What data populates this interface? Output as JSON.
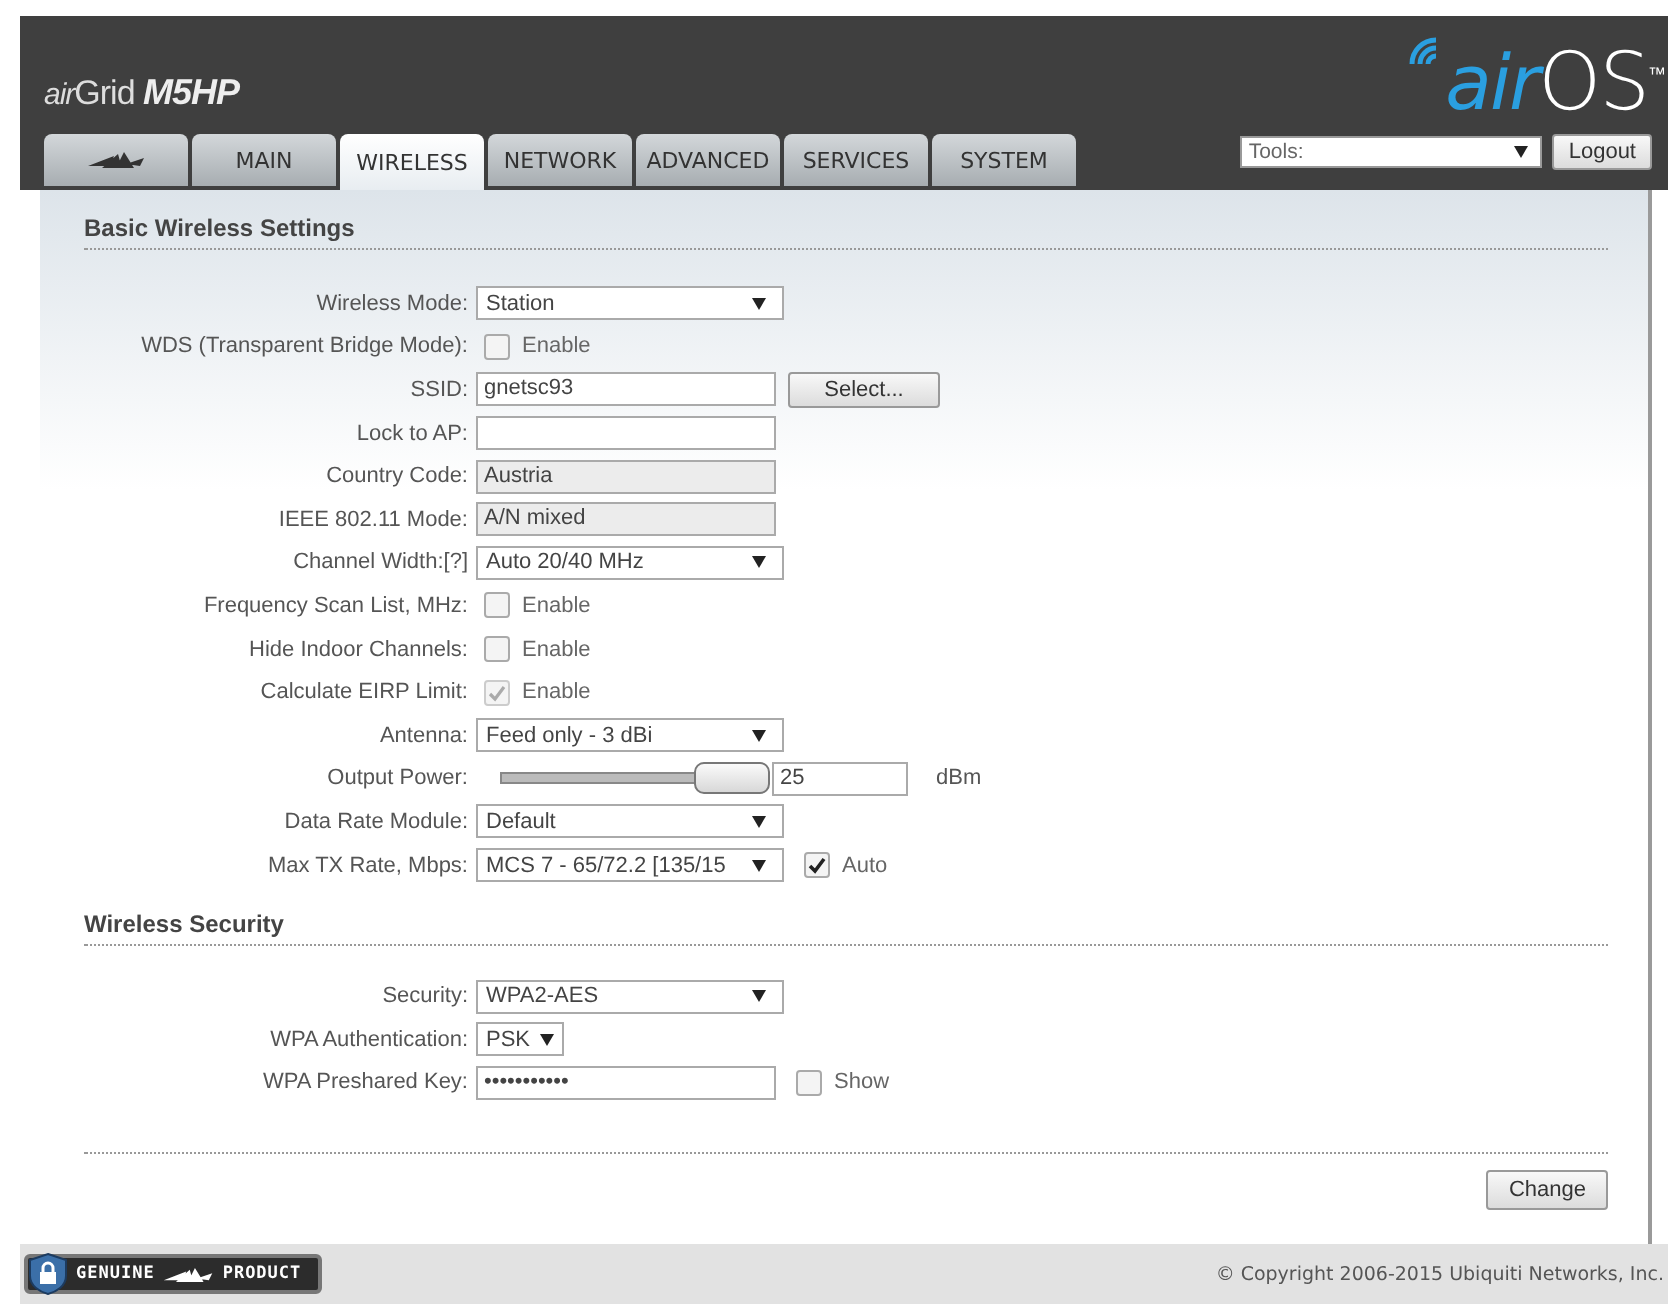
{
  "header": {
    "product": {
      "prefix": "air",
      "name": "Grid",
      "model": "M5HP"
    },
    "brand": {
      "prefix": "air",
      "name": "OS",
      "mark": "™"
    }
  },
  "tabs": [
    {
      "kind": "logo",
      "selected": false
    },
    {
      "kind": "text",
      "label": "MAIN",
      "selected": false
    },
    {
      "kind": "text",
      "label": "WIRELESS",
      "selected": true
    },
    {
      "kind": "text",
      "label": "NETWORK",
      "selected": false
    },
    {
      "kind": "text",
      "label": "ADVANCED",
      "selected": false
    },
    {
      "kind": "text",
      "label": "SERVICES",
      "selected": false
    },
    {
      "kind": "text",
      "label": "SYSTEM",
      "selected": false
    }
  ],
  "tools": {
    "value": "Tools:"
  },
  "logout": "Logout",
  "sections": [
    {
      "title": "Basic Wireless Settings",
      "rows": [
        {
          "kind": "select",
          "label": "Wireless Mode:",
          "value": "Station"
        },
        {
          "kind": "checkbox",
          "label": "WDS (Transparent Bridge Mode):",
          "checked": false,
          "disabled": false,
          "text": "Enable"
        },
        {
          "kind": "input",
          "label": "SSID:",
          "value": "gnetsc93",
          "button": "Select..."
        },
        {
          "kind": "input",
          "label": "Lock to AP:"
        },
        {
          "kind": "readonly",
          "label": "Country Code:",
          "value": "Austria"
        },
        {
          "kind": "readonly",
          "label": "IEEE 802.11 Mode:",
          "value": "A/N mixed"
        },
        {
          "kind": "select",
          "label": "Channel Width:[?]",
          "value": "Auto 20/40 MHz"
        },
        {
          "kind": "checkbox",
          "label": "Frequency Scan List, MHz:",
          "checked": false,
          "disabled": false,
          "text": "Enable"
        },
        {
          "kind": "checkbox",
          "label": "Hide Indoor Channels:",
          "checked": false,
          "disabled": false,
          "text": "Enable"
        },
        {
          "kind": "checkbox",
          "label": "Calculate EIRP Limit:",
          "checked": true,
          "disabled": true,
          "text": "Enable"
        },
        {
          "kind": "select",
          "label": "Antenna:",
          "value": "Feed only - 3 dBi"
        },
        {
          "kind": "slider",
          "label": "Output Power:",
          "level": 0.9,
          "value": "25",
          "unit": "dBm"
        },
        {
          "kind": "select",
          "label": "Data Rate Module:",
          "value": "Default"
        },
        {
          "kind": "select",
          "label": "Max TX Rate, Mbps:",
          "value": "MCS 7 - 65/72.2 [135/15",
          "extra": {
            "checked": true,
            "text": "Auto"
          }
        }
      ]
    },
    {
      "title": "Wireless Security",
      "rows": [
        {
          "kind": "select",
          "label": "Security:",
          "value": "WPA2-AES"
        },
        {
          "kind": "smallselect",
          "label": "WPA Authentication:",
          "value": "PSK"
        },
        {
          "kind": "password",
          "label": "WPA Preshared Key:",
          "value": "•••••••••••",
          "extra": {
            "checked": false,
            "text": "Show"
          }
        }
      ]
    }
  ],
  "change": "Change",
  "footer": {
    "badge_left": "GENUINE",
    "badge_right": "PRODUCT",
    "copyright": "© Copyright 2006-2015 Ubiquiti Networks, Inc."
  }
}
